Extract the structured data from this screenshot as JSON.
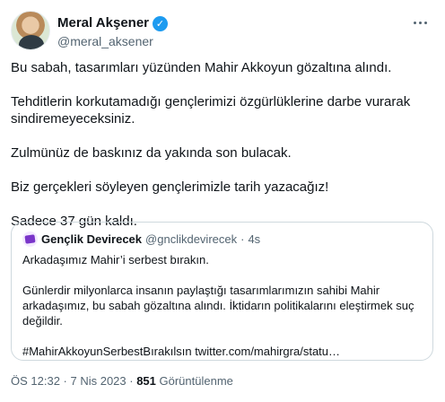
{
  "author": {
    "name": "Meral Akşener",
    "handle": "@meral_aksener"
  },
  "tweet": {
    "paragraphs": [
      "Bu sabah, tasarımları yüzünden Mahir Akkoyun gözaltına alındı.",
      "Tehditlerin korkutamadığı gençlerimizi özgürlüklerine darbe vurarak sindiremeyeceksiniz.",
      "Zulmünüz de baskınız da yakında son bulacak.",
      "Biz gerçekleri söyleyen gençlerimizle tarih yazacağız!",
      "Sadece 37 gün kaldı."
    ]
  },
  "quote": {
    "name": "Gençlik Devirecek",
    "handle": "@gnclikdevirecek",
    "separator": "·",
    "time": "4s",
    "paragraphs": [
      "Arkadaşımız Mahir’i serbest bırakın.",
      "Günlerdir milyonlarca insanın paylaştığı tasarımlarımızın sahibi Mahir arkadaşımız, bu sabah gözaltına alındı. İktidarın politikalarını eleştirmek suç değildir.",
      "#MahirAkkoyunSerbestBırakılsın twitter.com/mahirgra/statu…"
    ]
  },
  "meta": {
    "timestamp": "ÖS 12:32 · 7 Nis 2023 · ",
    "views_count": "851",
    "views_label": " Görüntülenme"
  },
  "colors": {
    "verified": "#1d9bf0",
    "muted_text": "#536471",
    "border": "#cfd9de"
  },
  "icons": {
    "verified": "verified-badge-icon",
    "more": "more-options-icon"
  }
}
